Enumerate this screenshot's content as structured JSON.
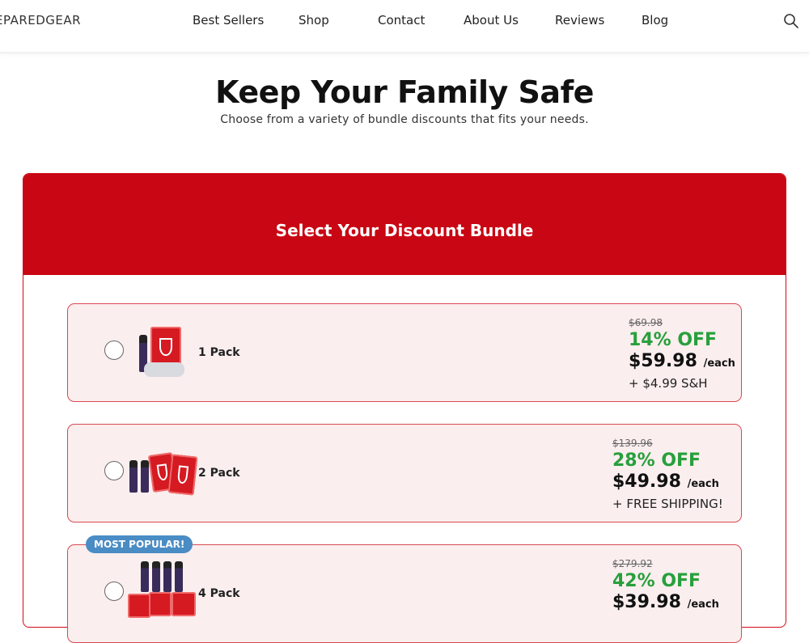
{
  "header": {
    "brand": "EPAREDGEAR",
    "nav": [
      "Best Sellers",
      "Shop",
      "Contact",
      "About Us",
      "Reviews",
      "Blog"
    ]
  },
  "hero": {
    "title": "Keep Your Family Safe",
    "subtitle": "Choose from a variety of bundle discounts that fits your needs."
  },
  "card": {
    "title": "Select Your Discount Bundle"
  },
  "badge": "MOST POPULAR!",
  "options": [
    {
      "label": "1 Pack",
      "old_price": "$69.98",
      "discount": "14% OFF",
      "price": "$59.98",
      "per": "/each",
      "shipping": "+ $4.99 S&H"
    },
    {
      "label": "2 Pack",
      "old_price": "$139.96",
      "discount": "28% OFF",
      "price": "$49.98",
      "per": "/each",
      "shipping": "+ FREE SHIPPING!"
    },
    {
      "label": "4 Pack",
      "old_price": "$279.92",
      "discount": "42% OFF",
      "price": "$39.98",
      "per": "/each",
      "shipping": ""
    }
  ],
  "colors": {
    "brand_red": "#c90613",
    "discount_green": "#27a03c",
    "badge_blue": "#4a8cc4"
  },
  "icons": {
    "search": "search-icon"
  }
}
